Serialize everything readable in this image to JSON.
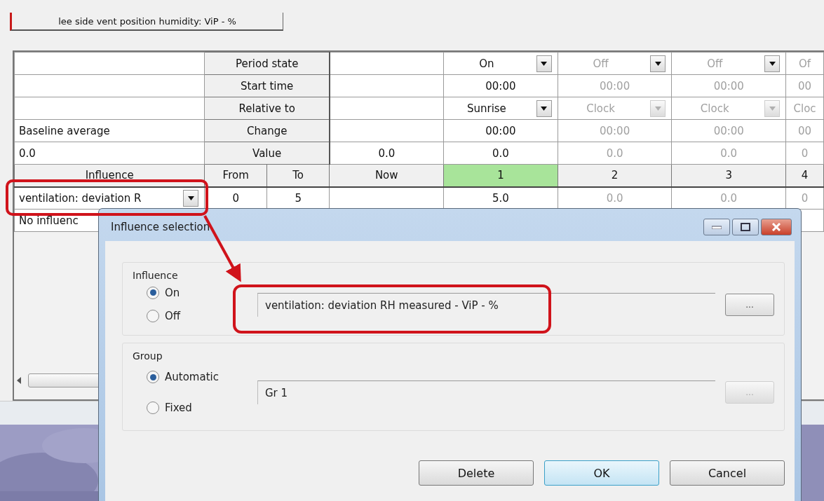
{
  "tab": {
    "label": "lee side vent position humidity: ViP - %",
    "selected": true
  },
  "grid": {
    "left_cells": [
      "",
      "",
      "",
      "Baseline average",
      "0.0"
    ],
    "parameters": [
      "Period state",
      "Start time",
      "Relative to",
      "Change",
      "Value"
    ],
    "now_cells": [
      "",
      "",
      "",
      "",
      "0.0"
    ],
    "headers": {
      "influence": "Influence",
      "from": "From",
      "to": "To",
      "now": "Now"
    },
    "periods": [
      {
        "number": "1",
        "selected": true,
        "disabled": false,
        "cut": false,
        "state": "On",
        "start_time": "00:00",
        "relative_to": "Sunrise",
        "change": "00:00",
        "value": "0.0",
        "influence_value": "5.0"
      },
      {
        "number": "2",
        "selected": false,
        "disabled": true,
        "cut": false,
        "state": "Off",
        "start_time": "00:00",
        "relative_to": "Clock",
        "change": "00:00",
        "value": "0.0",
        "influence_value": "0.0"
      },
      {
        "number": "3",
        "selected": false,
        "disabled": true,
        "cut": false,
        "state": "Off",
        "start_time": "00:00",
        "relative_to": "Clock",
        "change": "00:00",
        "value": "0.0",
        "influence_value": "0.0"
      },
      {
        "number": "4",
        "selected": false,
        "disabled": true,
        "cut": true,
        "state": "Of",
        "start_time": "00",
        "relative_to": "Cloc",
        "change": "00",
        "value": "0",
        "influence_value": "0"
      }
    ],
    "influence_rows": [
      {
        "kind": "dropdown",
        "name": "ventilation: deviation R",
        "from": "0",
        "to": "5"
      },
      {
        "kind": "plain",
        "name": "No influenc"
      }
    ]
  },
  "dialog": {
    "title": "Influence selection",
    "influence": {
      "label": "Influence",
      "options": [
        {
          "label": "On",
          "selected": true
        },
        {
          "label": "Off",
          "selected": false
        }
      ],
      "value": "ventilation: deviation RH measured - ViP - %",
      "browse": "...",
      "browse_disabled": false
    },
    "group": {
      "label": "Group",
      "options": [
        {
          "label": "Automatic",
          "selected": true
        },
        {
          "label": "Fixed",
          "selected": false
        }
      ],
      "value": "Gr 1",
      "browse": "...",
      "browse_disabled": true
    },
    "buttons": [
      {
        "label": "Delete",
        "default": false
      },
      {
        "label": "OK",
        "default": true
      },
      {
        "label": "Cancel",
        "default": false
      }
    ]
  }
}
